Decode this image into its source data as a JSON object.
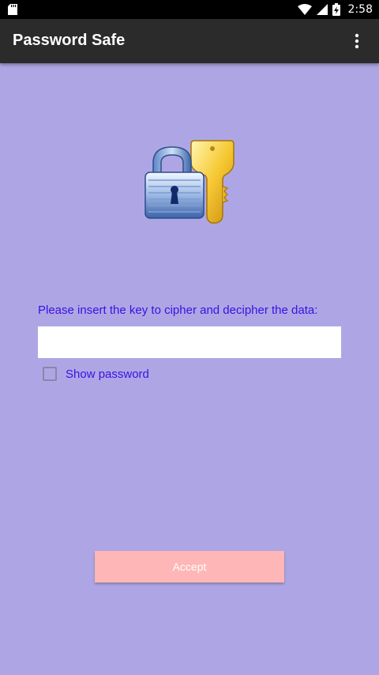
{
  "status_bar": {
    "time": "2:58",
    "icons": [
      "sd-card-icon",
      "wifi-icon",
      "signal-icon",
      "battery-charging-icon"
    ]
  },
  "app_bar": {
    "title": "Password Safe",
    "overflow_icon": "more-vert-icon"
  },
  "main": {
    "image_icon": "lock-and-key-icon",
    "prompt": "Please insert the key to cipher and decipher the data:",
    "key_input": {
      "value": "",
      "placeholder": ""
    },
    "show_password": {
      "label": "Show password",
      "checked": false
    },
    "accept_label": "Accept"
  },
  "colors": {
    "background": "#aea6e4",
    "app_bar": "#2b2b2b",
    "label_text": "#3a10e6",
    "accept_button": "#ffb6b6"
  }
}
